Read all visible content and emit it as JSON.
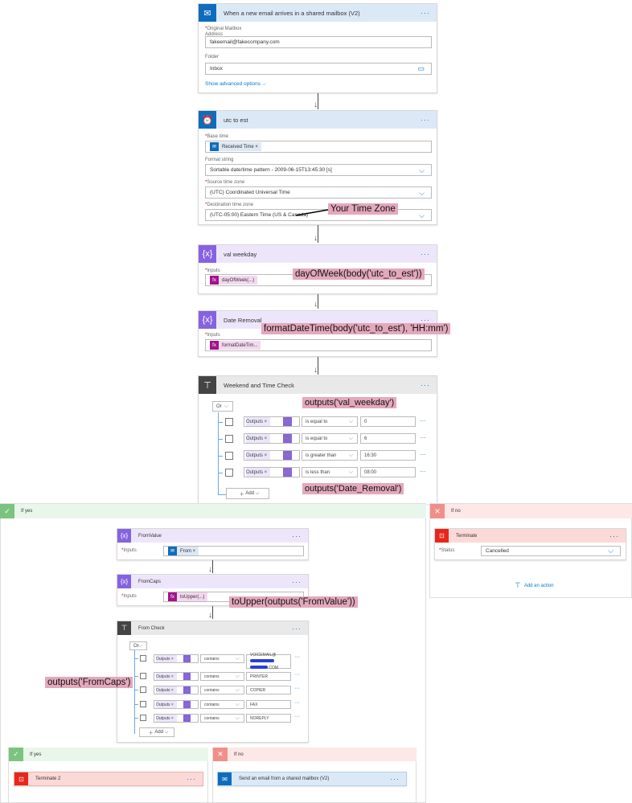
{
  "trigger": {
    "title": "When a new email arrives in a shared mailbox (V2)",
    "icon": "outlook-icon",
    "mailbox_label": "Original Mailbox Address",
    "mailbox_value": "fakeemail@fakecompany.com",
    "folder_label": "Folder",
    "folder_value": "Inbox",
    "advanced": "Show advanced options"
  },
  "utc": {
    "title": "utc to est",
    "icon": "clock-icon",
    "base_time_label": "Base time",
    "base_time_token": "Received Time",
    "format_label": "Format string",
    "format_value": "Sortable date/time pattern - 2009-06-15T13:45:30 [s]",
    "source_label": "Source time zone",
    "source_value": "(UTC) Coordinated Universal Time",
    "dest_label": "Destination time zone",
    "dest_value": "(UTC-05:00) Eastern Time (US & Canada)",
    "annotation": "Your Time Zone"
  },
  "weekday": {
    "title": "val weekday",
    "inputs_label": "Inputs",
    "token": "dayOfWeek(...)",
    "annotation": "dayOfWeek(body('utc_to_est'))"
  },
  "date_removal": {
    "title": "Date Removal",
    "inputs_label": "Inputs",
    "token": "formatDateTim...",
    "annotation": "formatDateTime(body('utc_to_est'), 'HH:mm')"
  },
  "weekend_check": {
    "title": "Weekend and Time Check",
    "group": "Or",
    "rows": [
      {
        "token": "Outputs",
        "op": "is equal to",
        "value": "0"
      },
      {
        "token": "Outputs",
        "op": "is equal to",
        "value": "6"
      },
      {
        "token": "Outputs",
        "op": "is greater than",
        "value": "16:30"
      },
      {
        "token": "Outputs",
        "op": "is less than",
        "value": "08:00"
      }
    ],
    "add": "Add",
    "annotation_top": "outputs('val_weekday')",
    "annotation_bottom": "outputs('Date_Removal')"
  },
  "if_yes": {
    "label": "If yes",
    "from_value": {
      "title": "FromValue",
      "inputs_label": "Inputs",
      "token": "From"
    },
    "from_caps": {
      "title": "FromCaps",
      "inputs_label": "Inputs",
      "token": "toUpper(...)",
      "annotation": "toUpper(outputs('FromValue'))"
    },
    "from_check": {
      "title": "From Check",
      "group": "Or",
      "rows": [
        {
          "token": "Outputs",
          "op": "contains",
          "value": "VOICEMAIL@",
          "value2": ".COM"
        },
        {
          "token": "Outputs",
          "op": "contains",
          "value": "PRINTER"
        },
        {
          "token": "Outputs",
          "op": "contains",
          "value": "COPIER"
        },
        {
          "token": "Outputs",
          "op": "contains",
          "value": "FAX"
        },
        {
          "token": "Outputs",
          "op": "contains",
          "value": "NOREPLY"
        }
      ],
      "add": "Add",
      "annotation": "outputs('FromCaps')"
    },
    "inner_yes": {
      "label": "If yes",
      "action": "Terminate 2"
    },
    "inner_no": {
      "label": "If no",
      "action": "Send an email from a shared mailbox (V2)"
    }
  },
  "if_no": {
    "label": "If no",
    "terminate": {
      "title": "Terminate",
      "status_label": "Status",
      "status_value": "Cancelled"
    },
    "add_action": "Add an action"
  }
}
